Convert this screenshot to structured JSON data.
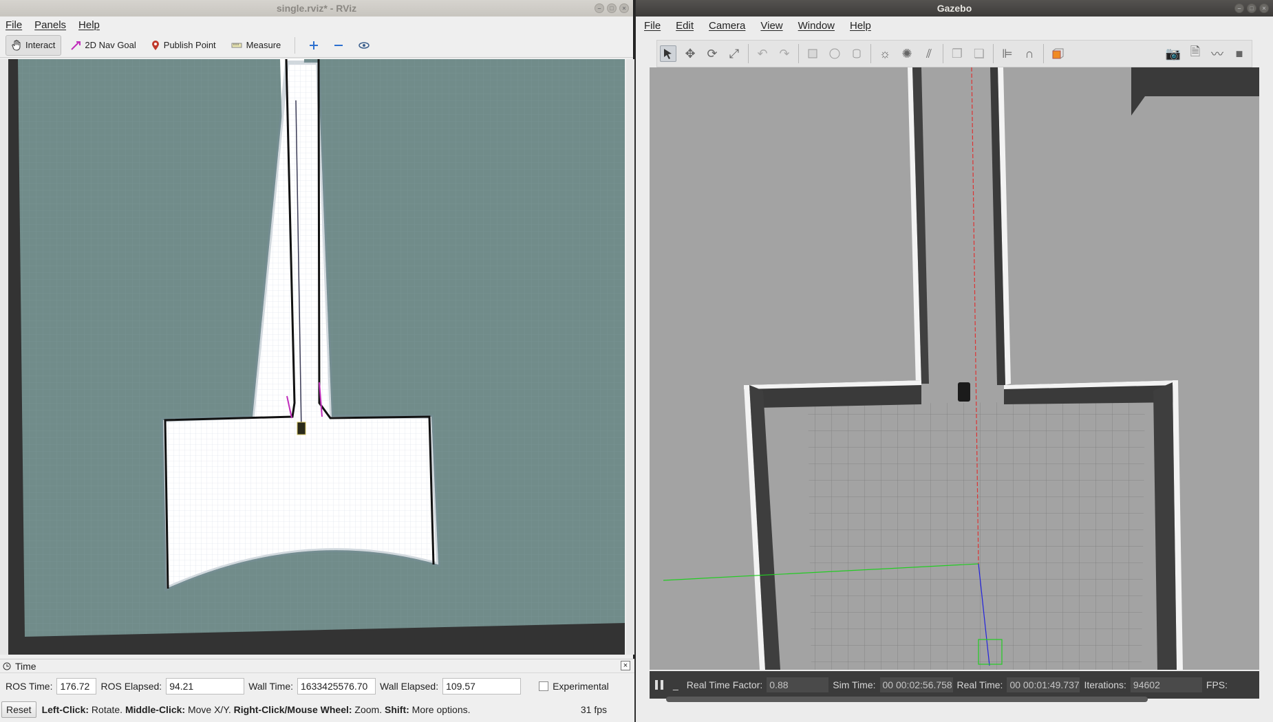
{
  "rviz": {
    "title": "single.rviz* - RViz",
    "menu": [
      "File",
      "Panels",
      "Help"
    ],
    "toolbar": {
      "interact": "Interact",
      "nav_goal": "2D Nav Goal",
      "publish_point": "Publish Point",
      "measure": "Measure"
    },
    "time_panel": {
      "title": "Time",
      "ros_time_label": "ROS Time:",
      "ros_time": "176.72",
      "ros_elapsed_label": "ROS Elapsed:",
      "ros_elapsed": "94.21",
      "wall_time_label": "Wall Time:",
      "wall_time": "1633425576.70",
      "wall_elapsed_label": "Wall Elapsed:",
      "wall_elapsed": "109.57",
      "experimental": "Experimental"
    },
    "status": {
      "reset": "Reset",
      "lc_bold": "Left-Click:",
      "lc": " Rotate. ",
      "mc_bold": "Middle-Click:",
      "mc": " Move X/Y. ",
      "rc_bold": "Right-Click/Mouse Wheel:",
      "rc": " Zoom. ",
      "shift_bold": "Shift:",
      "shift": " More options.",
      "fps": "31 fps"
    }
  },
  "gazebo": {
    "title": "Gazebo",
    "menu": [
      "File",
      "Edit",
      "Camera",
      "View",
      "Window",
      "Help"
    ],
    "bottom": {
      "rtf_label": "Real Time Factor:",
      "rtf": "0.88",
      "sim_label": "Sim Time:",
      "sim": "00 00:02:56.758",
      "real_label": "Real Time:",
      "real": "00 00:01:49.737",
      "iter_label": "Iterations:",
      "iter": "94602",
      "fps_label": "FPS:"
    }
  }
}
